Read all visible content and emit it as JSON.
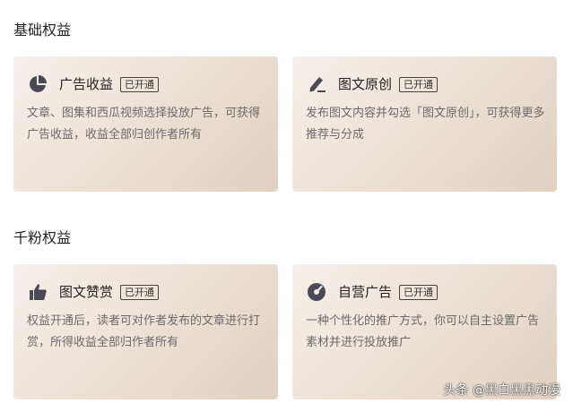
{
  "sections": [
    {
      "title": "基础权益",
      "cards": [
        {
          "icon": "pie-chart-icon",
          "title": "广告收益",
          "badge": "已开通",
          "desc": "文章、图集和西瓜视频选择投放广告，可获得广告收益，收益全部归创作者所有"
        },
        {
          "icon": "pen-icon",
          "title": "图文原创",
          "badge": "已开通",
          "desc": "发布图文内容并勾选「图文原创」，可获得更多推荐与分成"
        }
      ]
    },
    {
      "title": "千粉权益",
      "cards": [
        {
          "icon": "thumbs-up-icon",
          "title": "图文赞赏",
          "badge": "已开通",
          "desc": "权益开通后，读者可对作者发布的文章进行打赏，所得收益全部归作者所有"
        },
        {
          "icon": "gauge-icon",
          "title": "自营广告",
          "badge": "已开通",
          "desc": "一种个性化的推广方式，你可以自主设置广告素材并进行投放推广"
        }
      ]
    }
  ],
  "watermark": "头条 @黑白黑黑动漫",
  "colors": {
    "icon": "#4a4a55",
    "card_gradient_start": "#f6f0ea",
    "card_gradient_end": "#e0d0c2"
  }
}
